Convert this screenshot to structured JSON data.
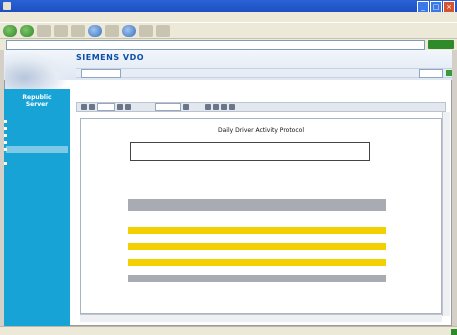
{
  "window": {
    "title": "",
    "controls": [
      "_",
      "□",
      "×"
    ]
  },
  "menubar": {
    "items": [
      "",
      "",
      "",
      "",
      "",
      ""
    ]
  },
  "toolbar": {
    "buttons": [
      "back",
      "forward",
      "stop",
      "refresh",
      "home",
      "search",
      "favorites",
      "history",
      "mail",
      "print"
    ]
  },
  "address": {
    "label": "",
    "value": "",
    "go_label": ""
  },
  "header": {
    "brand": "SIEMENS VDO",
    "info_left": "",
    "info_mid": "",
    "info_right": ""
  },
  "sidebar": {
    "title_line1": "Republic",
    "title_line2": "Server",
    "items": [
      {
        "label": "",
        "active": false,
        "sub": false
      },
      {
        "label": "",
        "active": false,
        "sub": false
      },
      {
        "label": "",
        "active": false,
        "sub": false
      },
      {
        "label": "",
        "active": false,
        "sub": false
      },
      {
        "label": "",
        "active": true,
        "sub": false
      },
      {
        "label": "",
        "active": false,
        "sub": true
      },
      {
        "label": "",
        "active": false,
        "sub": false
      }
    ]
  },
  "report": {
    "title": "Daily Driver Activity Protocol",
    "info": [
      "",
      "",
      "",
      "",
      "",
      ""
    ],
    "meta": [
      "",
      "",
      "",
      "",
      "",
      ""
    ],
    "table": {
      "headers": [
        "",
        "",
        "",
        "",
        "",
        "",
        "",
        "",
        "",
        "",
        ""
      ],
      "rows": [
        {
          "style": "white",
          "cells": [
            "",
            "",
            "",
            "",
            "",
            "",
            "",
            "",
            "",
            "",
            ""
          ]
        },
        {
          "style": "white",
          "cells": [
            "",
            "",
            "",
            "",
            "",
            "",
            "",
            "",
            "",
            "",
            ""
          ]
        },
        {
          "style": "yellow",
          "cells": [
            "",
            "",
            "",
            "",
            "",
            "",
            "",
            "",
            "",
            "",
            ""
          ]
        },
        {
          "style": "white",
          "cells": [
            "",
            "",
            "",
            "",
            "",
            "",
            "",
            "",
            "",
            "",
            ""
          ]
        },
        {
          "style": "yellow",
          "cells": [
            "",
            "",
            "",
            "",
            "",
            "",
            "",
            "",
            "",
            "",
            ""
          ]
        },
        {
          "style": "white",
          "cells": [
            "",
            "",
            "",
            "",
            "",
            "",
            "",
            "",
            "",
            "",
            ""
          ]
        },
        {
          "style": "yellow",
          "cells": [
            "",
            "",
            "",
            "",
            "",
            "",
            "",
            "",
            "",
            "",
            ""
          ]
        },
        {
          "style": "white",
          "cells": [
            "",
            "",
            "",
            "",
            "",
            "",
            "",
            "",
            "",
            "",
            ""
          ]
        },
        {
          "style": "gray",
          "cells": [
            "",
            "",
            "",
            "",
            "",
            "",
            "",
            "",
            "",
            "",
            ""
          ]
        }
      ]
    },
    "footer_meta": [
      "",
      "",
      "",
      ""
    ]
  },
  "status": {
    "left": "",
    "right": ""
  },
  "colors": {
    "sidebar": "#18a3d6",
    "highlight": "#f3d100",
    "table_header": "#a8acb2",
    "brand": "#0b4fa8"
  }
}
